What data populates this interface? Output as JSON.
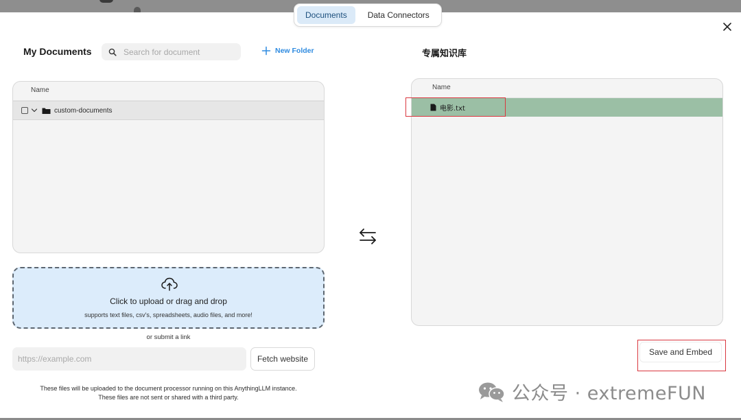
{
  "tabs": [
    {
      "label": "Documents",
      "active": true
    },
    {
      "label": "Data Connectors",
      "active": false
    }
  ],
  "left": {
    "title": "My Documents",
    "search_placeholder": "Search for document",
    "new_folder_label": "New Folder",
    "column_name": "Name",
    "folders": [
      {
        "name": "custom-documents",
        "expanded": true
      }
    ]
  },
  "right": {
    "title": "专属知识库",
    "column_name": "Name",
    "files": [
      {
        "name": "电影.txt",
        "highlighted": true
      }
    ],
    "save_label": "Save and Embed"
  },
  "upload": {
    "title": "Click to upload or drag and drop",
    "subtitle": "supports text files, csv's, spreadsheets, audio files, and more!",
    "or_link": "or submit a link",
    "url_placeholder": "https://example.com",
    "fetch_label": "Fetch website",
    "note_line1": "These files will be uploaded to the document processor running on this AnythingLLM instance.",
    "note_line2": "These files are not sent or shared with a third party."
  },
  "watermark": {
    "text": "公众号 · extremeFUN"
  },
  "colors": {
    "accent": "#2f8be0",
    "tab_active_bg": "#dbeaf8",
    "file_highlight": "#9bbfa5",
    "upload_bg": "#dcecfb",
    "annotation_red": "#d9363e"
  }
}
